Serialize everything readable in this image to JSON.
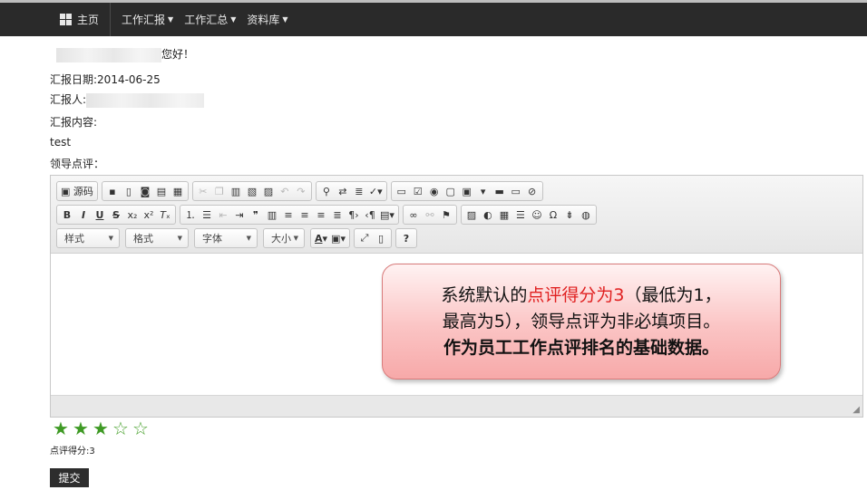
{
  "nav": {
    "home": "主页",
    "items": [
      "工作汇报",
      "工作汇总",
      "资料库"
    ]
  },
  "greeting": "您好！",
  "report": {
    "date_label": "汇报日期:",
    "date_value": "2014-06-25",
    "reporter_label": "汇报人:",
    "content_label": "汇报内容:",
    "content_value": "test",
    "review_label": "领导点评："
  },
  "editor": {
    "source_label": "源码",
    "combos": {
      "style": "样式",
      "format": "格式",
      "font": "字体",
      "size": "大小"
    }
  },
  "callout": {
    "line1_a": "系统默认的",
    "line1_b": "点评得分为3",
    "line1_c": "（最低为1，",
    "line2": "最高为5），领导点评为非必填项目。",
    "line3": "作为员工工作点评排名的基础数据。"
  },
  "rating": {
    "value": 3,
    "max": 5,
    "score_text": "点评得分:3"
  },
  "submit_label": "提交",
  "colors": {
    "navbar": "#2a2a2a",
    "star": "#3f9a25",
    "callout_highlight": "#e02020"
  }
}
